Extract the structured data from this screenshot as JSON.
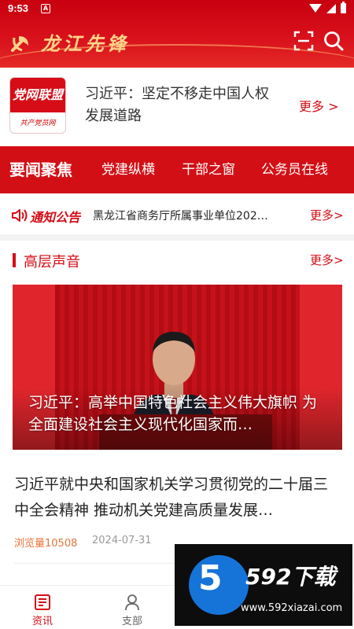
{
  "status_bar": {
    "time": "9:53",
    "notification_icon": "A"
  },
  "header": {
    "title": "龙江先锋"
  },
  "top_news": {
    "logo_text": "党网联盟",
    "logo_sub": "共产党员网",
    "title": "习近平：坚定不移走中国人权发展道路",
    "more": "更多 >"
  },
  "tabs": [
    {
      "label": "要闻聚焦"
    },
    {
      "label": "党建纵横"
    },
    {
      "label": "干部之窗"
    },
    {
      "label": "公务员在线"
    }
  ],
  "notice": {
    "label": "通知公告",
    "text": "黑龙江省商务厅所属事业单位202…",
    "more": "更多>"
  },
  "section": {
    "title": "高层声音",
    "more": "更多>"
  },
  "feature": {
    "caption": "习近平：高举中国特色社会主义伟大旗帜 为全面建设社会主义现代化国家而…"
  },
  "article": {
    "title": "习近平就中央和国家机关学习贯彻党的二十届三中全会精神 推动机关党建高质量发展…",
    "views": "浏览量10508",
    "date": "2024-07-31"
  },
  "bottom_nav": [
    {
      "label": "资讯",
      "icon": "news-icon",
      "color": "#d40c16"
    },
    {
      "label": "支部",
      "icon": "branch-icon",
      "color": "#666666"
    }
  ],
  "watermark": {
    "brand": "592下载",
    "url": "www.592xiazai.com",
    "digit": "5"
  },
  "colors": {
    "primary": "#d40c16",
    "accent_gold": "#ffd48a",
    "views": "#e8743b"
  }
}
